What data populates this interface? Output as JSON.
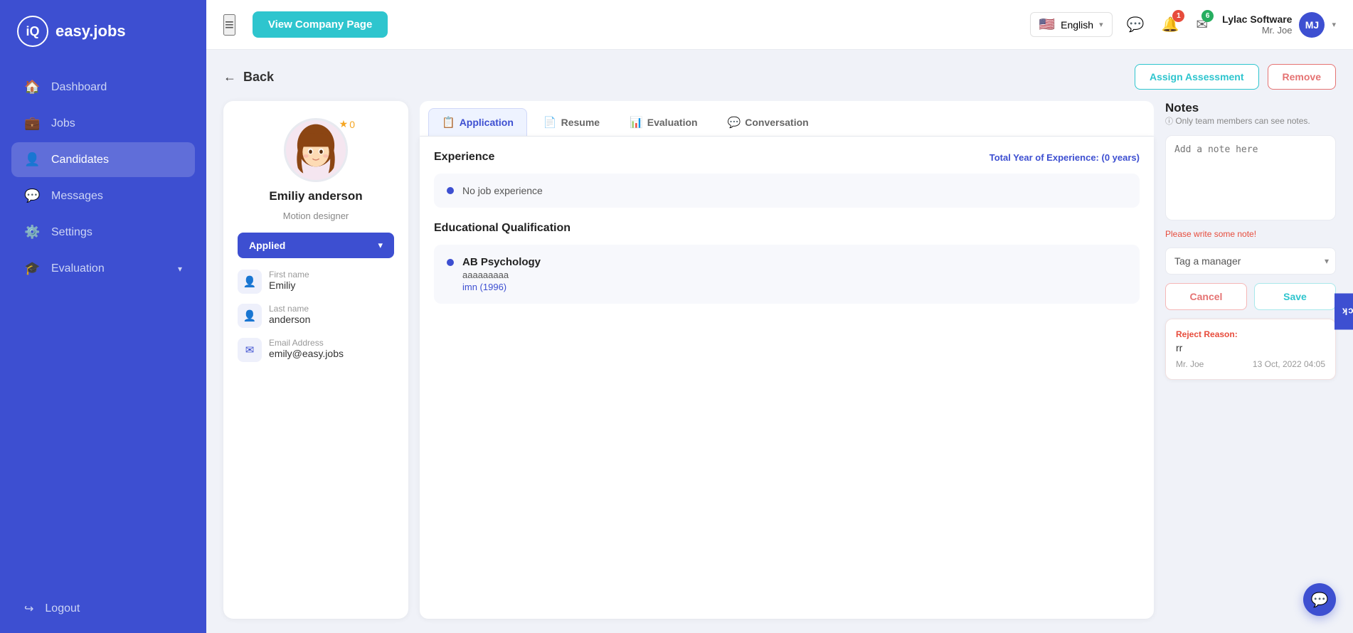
{
  "app": {
    "name": "easy.jobs"
  },
  "sidebar": {
    "items": [
      {
        "id": "dashboard",
        "label": "Dashboard",
        "icon": "🏠",
        "active": false
      },
      {
        "id": "jobs",
        "label": "Jobs",
        "icon": "💼",
        "active": false
      },
      {
        "id": "candidates",
        "label": "Candidates",
        "icon": "👤",
        "active": true
      },
      {
        "id": "messages",
        "label": "Messages",
        "icon": "💬",
        "active": false
      },
      {
        "id": "settings",
        "label": "Settings",
        "icon": "⚙️",
        "active": false
      },
      {
        "id": "evaluation",
        "label": "Evaluation",
        "icon": "🎓",
        "active": false
      }
    ],
    "logout_label": "Logout"
  },
  "topbar": {
    "hamburger": "≡",
    "company_btn": "View Company Page",
    "language": "English",
    "notifications_badge": "1",
    "messages_badge": "6",
    "user": {
      "company": "Lylac Software",
      "name": "Mr. Joe"
    }
  },
  "back_btn": "Back",
  "actions": {
    "assign": "Assign Assessment",
    "remove": "Remove"
  },
  "candidate": {
    "name": "Emiliy anderson",
    "title": "Motion designer",
    "stars": "0",
    "status": "Applied",
    "first_name_label": "First name",
    "first_name": "Emiliy",
    "last_name_label": "Last name",
    "last_name": "anderson",
    "email_label": "Email Address",
    "email": "emily@easy.jobs"
  },
  "tabs": [
    {
      "id": "application",
      "label": "Application",
      "icon": "📋",
      "active": true
    },
    {
      "id": "resume",
      "label": "Resume",
      "icon": "📄",
      "active": false
    },
    {
      "id": "evaluation",
      "label": "Evaluation",
      "icon": "📊",
      "active": false
    },
    {
      "id": "conversation",
      "label": "Conversation",
      "icon": "💬",
      "active": false
    }
  ],
  "application": {
    "experience_title": "Experience",
    "total_exp_label": "Total Year of Experience:",
    "total_exp_value": "(0 years)",
    "no_experience": "No job experience",
    "edu_title": "Educational Qualification",
    "education": {
      "degree": "AB Psychology",
      "institution": "aaaaaaaaa",
      "year": "imn (1996)"
    }
  },
  "notes": {
    "title": "Notes",
    "subtitle": "Only team members can see notes.",
    "placeholder": "Add a note here",
    "error": "Please write some note!",
    "tag_placeholder": "Tag a manager",
    "cancel_label": "Cancel",
    "save_label": "Save"
  },
  "reject": {
    "label": "Reject Reason:",
    "value": "rr",
    "author": "Mr. Joe",
    "timestamp": "13 Oct, 2022 04:05"
  },
  "feedback_tab": "Feedback"
}
